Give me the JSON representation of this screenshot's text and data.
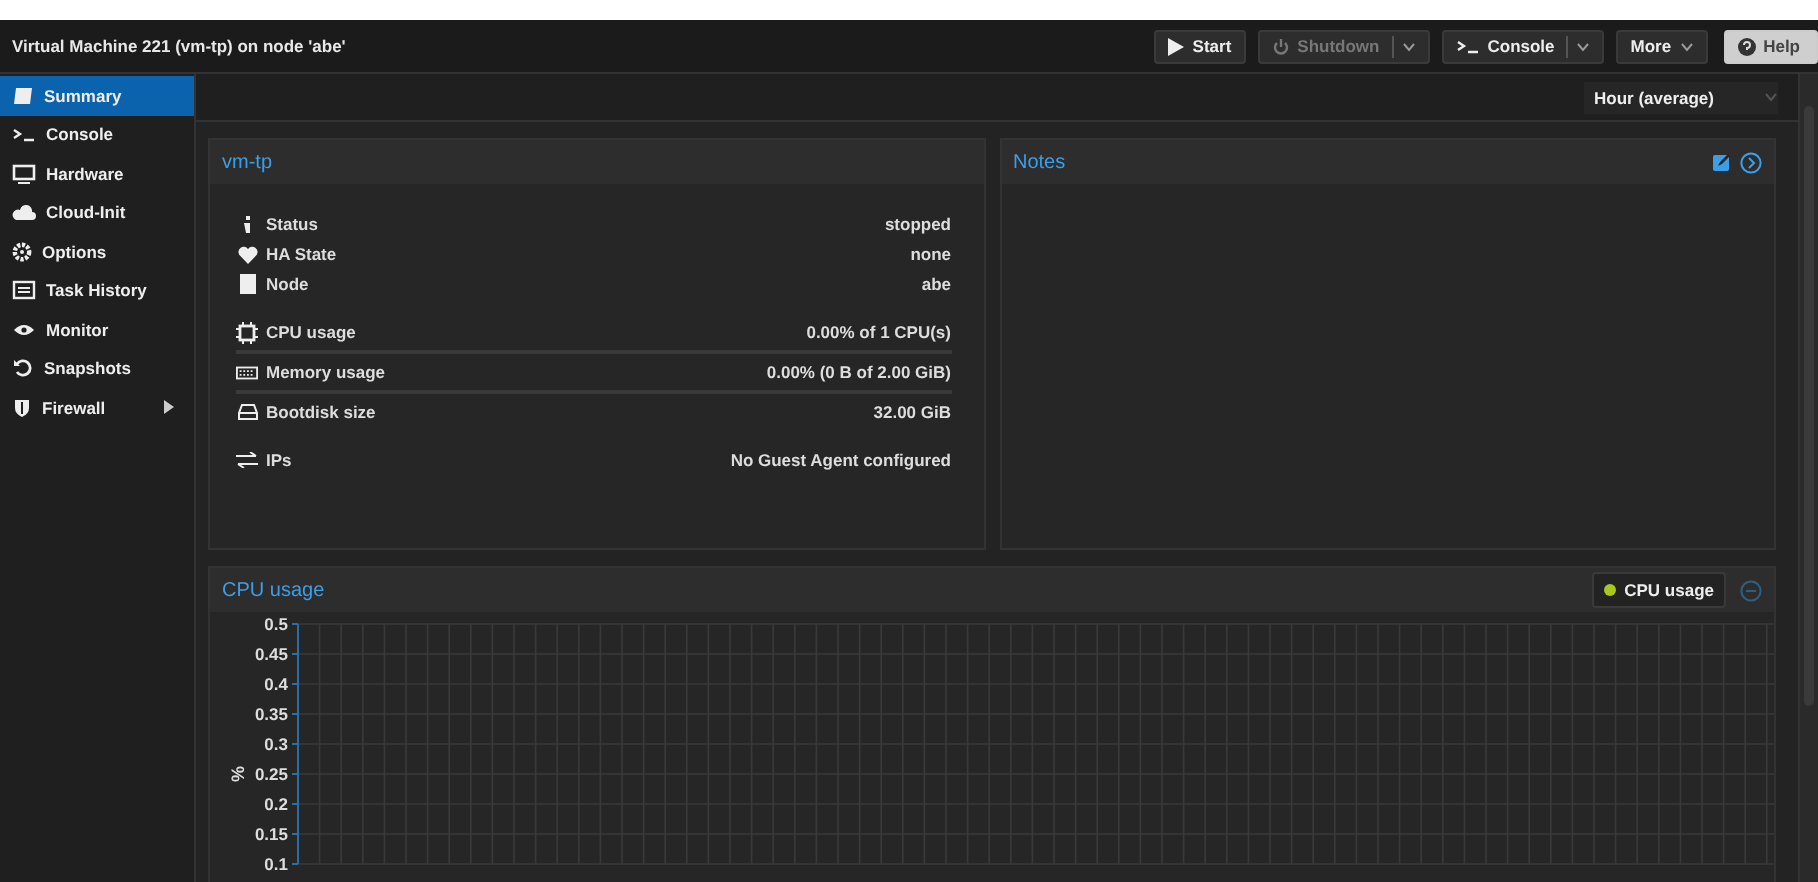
{
  "window": {
    "title": "Virtual Machine 221 (vm-tp) on node 'abe'"
  },
  "toolbar": [
    {
      "label": "Start",
      "disabled": false,
      "kind": "play"
    },
    {
      "label": "Shutdown",
      "disabled": true,
      "kind": "split"
    },
    {
      "label": "Console",
      "disabled": false,
      "kind": "split"
    },
    {
      "label": "More",
      "disabled": false,
      "kind": "menu"
    },
    {
      "label": "Help",
      "disabled": false,
      "kind": "help"
    }
  ],
  "sidebar": {
    "items": [
      {
        "label": "Summary",
        "selected": true
      },
      {
        "label": "Console",
        "selected": false
      },
      {
        "label": "Hardware",
        "selected": false
      },
      {
        "label": "Cloud-Init",
        "selected": false
      },
      {
        "label": "Options",
        "selected": false
      },
      {
        "label": "Task History",
        "selected": false
      },
      {
        "label": "Monitor",
        "selected": false
      },
      {
        "label": "Snapshots",
        "selected": false
      },
      {
        "label": "Firewall",
        "selected": false,
        "expanded": false
      }
    ]
  },
  "timeframe": {
    "value": "Hour (average)"
  },
  "status_panel": {
    "title": "vm-tp",
    "groups": [
      [
        {
          "label": "Status",
          "value": "stopped"
        },
        {
          "label": "HA State",
          "value": "none"
        },
        {
          "label": "Node",
          "value": "abe"
        }
      ],
      [
        {
          "label": "CPU usage",
          "value": "0.00% of 1 CPU(s)",
          "level": 0
        },
        {
          "label": "Memory usage",
          "value": "0.00% (0 B of 2.00 GiB)",
          "level": 0
        },
        {
          "label": "Bootdisk size",
          "value": "32.00 GiB"
        }
      ],
      [
        {
          "label": "IPs",
          "value": "No Guest Agent configured"
        }
      ]
    ]
  },
  "notes_panel": {
    "title": "Notes"
  },
  "cpu_panel": {
    "title": "CPU usage",
    "chart_data": {
      "type": "line",
      "grid": true,
      "ylabel": "%",
      "ylim": [
        0.1,
        0.5
      ],
      "yticks": [
        0.5,
        0.45,
        0.4,
        0.35,
        0.3,
        0.25,
        0.2,
        0.15,
        0.1
      ],
      "series": [
        {
          "name": "CPU usage",
          "color": "#a8c81e"
        }
      ]
    }
  }
}
